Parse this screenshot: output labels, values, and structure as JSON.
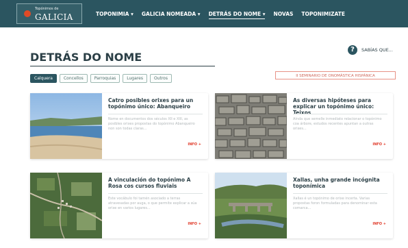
{
  "site": {
    "logo_top": "Topónimos de",
    "logo_main": "GALICIA"
  },
  "nav": [
    {
      "label": "TOPONIMIA ▾",
      "active": false
    },
    {
      "label": "GALICIA NOMEADA ▾",
      "active": false
    },
    {
      "label": "DETRÁS DO NOME ▾",
      "active": true
    },
    {
      "label": "NOVAS",
      "active": false
    },
    {
      "label": "TOPONIMIZATE",
      "active": false
    }
  ],
  "page": {
    "title": "DETRÁS DO NOME",
    "saber_icon": "?",
    "saber_label": "SABÍAS QUE..."
  },
  "filters": [
    {
      "label": "Calquera",
      "active": true
    },
    {
      "label": "Concellos",
      "active": false
    },
    {
      "label": "Parroquias",
      "active": false
    },
    {
      "label": "Lugares",
      "active": false
    },
    {
      "label": "Outros",
      "active": false
    }
  ],
  "seminar_label": "II SEMINARIO DE ONOMÁSTICA HISPÁNICA",
  "cards": [
    {
      "title": "Catro posibles orixes para un topónimo único: Abanqueiro",
      "text": "Nome en documentos dos séculos XII e XIII, as posibles orixes propostas do topónimo Abanqueiro non son todas claras...",
      "more": "INFO +",
      "image": "beach-estuary"
    },
    {
      "title": "As diversas hipóteses para explicar un topónimo único: Teixos",
      "text": "Aínda que semelle inmediato relacionar o topónimo coa árbore, estudos recentes apuntan a outras orixes...",
      "more": "INFO +",
      "image": "stone-wall"
    },
    {
      "title": "A vinculación do topónimo A Rosa cos cursos fluviais",
      "text": "Este vocábulo foi tamén asociado a terras atravesadas por auga, o que permite explicar a súa orixe en varios lugares...",
      "more": "INFO +",
      "image": "aerial-valley"
    },
    {
      "title": "Xallas, unha grande incógnita toponímica",
      "text": "Xallas é un topónimo de orixe incerta. Varias propostas foron formuladas para denominar esta comarca...",
      "more": "INFO +",
      "image": "river-bridge"
    }
  ]
}
